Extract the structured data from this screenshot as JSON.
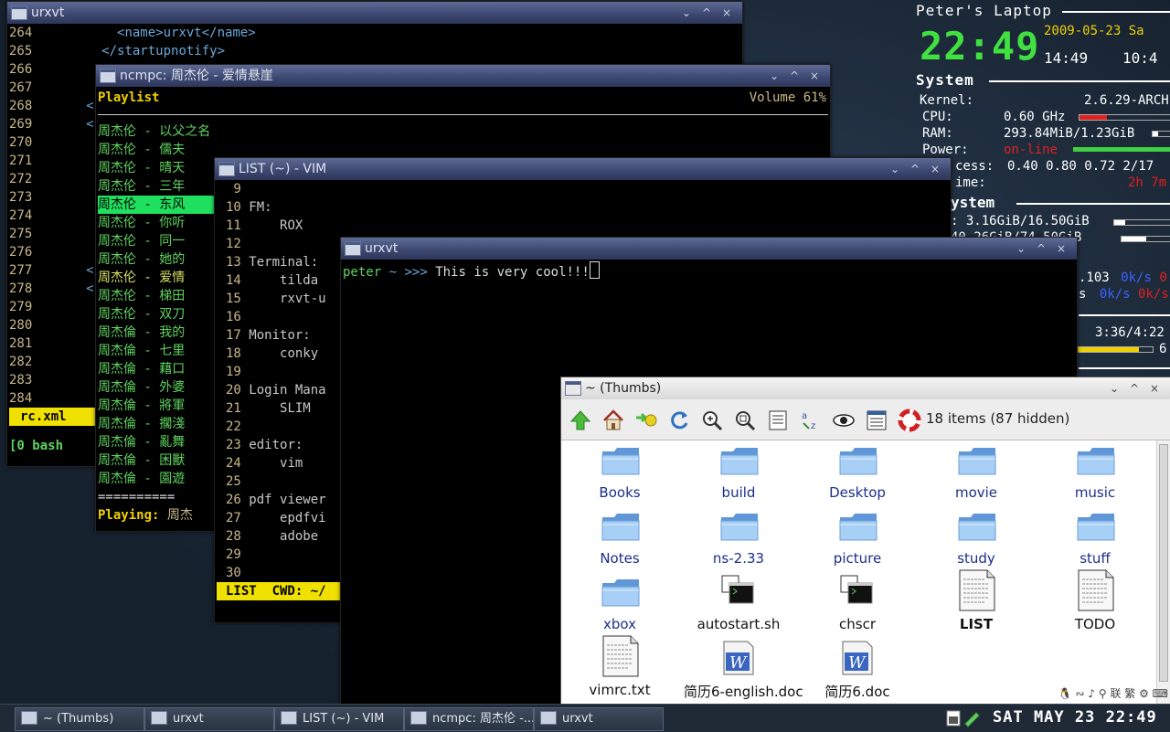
{
  "colors": {
    "accent": "#f0e000",
    "green": "#5fd35f",
    "xml_tag": "#6aa7d8",
    "line_no": "#c8b88a",
    "conky_red": "#e02020",
    "conky_green": "#40d040"
  },
  "win_urxvt1": {
    "title": "urxvt",
    "controls": [
      "⌄",
      "^",
      "×"
    ],
    "lines": [
      {
        "n": "264",
        "t": "        <name>urxvt</name>"
      },
      {
        "n": "265",
        "t": "      </startupnotify>"
      },
      {
        "n": "266",
        "t": ""
      },
      {
        "n": "267",
        "t": ""
      },
      {
        "n": "268",
        "t": "    </"
      },
      {
        "n": "269",
        "t": "    <"
      },
      {
        "n": "270",
        "t": ""
      },
      {
        "n": "271",
        "t": ""
      },
      {
        "n": "272",
        "t": ""
      },
      {
        "n": "273",
        "t": ""
      },
      {
        "n": "274",
        "t": ""
      },
      {
        "n": "275",
        "t": ""
      },
      {
        "n": "276",
        "t": ""
      },
      {
        "n": "277",
        "t": "    </"
      },
      {
        "n": "278",
        "t": "    <"
      },
      {
        "n": "279",
        "t": ""
      },
      {
        "n": "280",
        "t": ""
      },
      {
        "n": "281",
        "t": ""
      },
      {
        "n": "282",
        "t": ""
      },
      {
        "n": "283",
        "t": ""
      },
      {
        "n": "284",
        "t": ""
      }
    ],
    "status_file": "rc.xml",
    "tmux": "[0 bash"
  },
  "win_ncmpc": {
    "title": "ncmpc: 周杰伦 - 爱情悬崖",
    "controls": [
      "⌄",
      "^",
      "×"
    ],
    "header_left": "Playlist",
    "header_right": "Volume 61%",
    "songs": [
      "周杰伦 - 以父之名",
      "周杰伦 - 儒夫",
      "周杰伦 - 晴天",
      "周杰伦 - 三年",
      "周杰伦 - 东风",
      "周杰伦 - 你听",
      "周杰伦 - 同一",
      "周杰伦 - 她的",
      "周杰伦 - 爱情",
      "周杰伦 - 梯田",
      "周杰伦 - 双刀",
      "周杰倫 - 我的",
      "周杰倫 - 七里",
      "周杰倫 - 藉口",
      "周杰倫 - 外婆",
      "周杰倫 - 將軍",
      "周杰倫 - 擱淺",
      "周杰倫 - 亂舞",
      "周杰倫 - 困獸",
      "周杰倫 - 園遊"
    ],
    "selected_index": 4,
    "separator": "==========",
    "playing_label": "Playing:",
    "playing_value": "周杰"
  },
  "win_vim": {
    "title": "LIST (~) - VIM",
    "controls": [
      "⌄",
      "^",
      "×"
    ],
    "lines": [
      {
        "n": " 9",
        "t": ""
      },
      {
        "n": "10",
        "t": "FM:"
      },
      {
        "n": "11",
        "t": "    ROX"
      },
      {
        "n": "12",
        "t": ""
      },
      {
        "n": "13",
        "t": "Terminal:"
      },
      {
        "n": "14",
        "t": "    tilda"
      },
      {
        "n": "15",
        "t": "    rxvt-u"
      },
      {
        "n": "16",
        "t": ""
      },
      {
        "n": "17",
        "t": "Monitor:"
      },
      {
        "n": "18",
        "t": "    conky"
      },
      {
        "n": "19",
        "t": ""
      },
      {
        "n": "20",
        "t": "Login Mana"
      },
      {
        "n": "21",
        "t": "    SLIM"
      },
      {
        "n": "22",
        "t": ""
      },
      {
        "n": "23",
        "t": "editor:"
      },
      {
        "n": "24",
        "t": "    vim"
      },
      {
        "n": "25",
        "t": ""
      },
      {
        "n": "26",
        "t": "pdf viewer"
      },
      {
        "n": "27",
        "t": "    epdfvi"
      },
      {
        "n": "28",
        "t": "    adobe"
      },
      {
        "n": "29",
        "t": ""
      },
      {
        "n": "30",
        "t": ""
      }
    ],
    "status": "LIST  CWD: ~/"
  },
  "win_urxvt2": {
    "title": "urxvt",
    "controls": [
      "⌄",
      "^",
      "×"
    ],
    "prompt_user": "peter",
    "prompt_path": "~",
    "prompt_sym": ">>>",
    "command": "This is very cool!!!"
  },
  "conky": {
    "host": "Peter's Laptop",
    "time_big": "22:49",
    "date": "2009-05-23 Sa",
    "time_a": "14:49",
    "time_b": "10:4",
    "sec_system": "System",
    "kernel_label": "Kernel:",
    "kernel_val": "2.6.29-ARCH",
    "cpu_label": "CPU:",
    "cpu_val": "0.60 GHz",
    "ram_label": "RAM:",
    "ram_val": "293.84MiB/1.23GiB",
    "power_label": "Power:",
    "power_val": "on-line",
    "process_label": "cess:",
    "process_val": "0.40 0.80 0.72 2/17",
    "uptime_label": "ime:",
    "uptime_val": "2h 7m",
    "sec_fs": "ystem",
    "fs1": ": 3.16GiB/16.50GiB",
    "fs2": "40.26GiB/74.50GiB",
    "net1a": ".103",
    "net1b": "0k/s",
    "net1c": "0",
    "net2a": "s",
    "net2b": "0k/s",
    "net2c": "0k/s",
    "mpd_time": "3:36/4:22",
    "mpd_vol": "6"
  },
  "filemanager": {
    "title": "~ (Thumbs)",
    "controls": [
      "⌄",
      "^",
      "×"
    ],
    "summary": "18 items (87 hidden)",
    "toolbar": [
      "up-icon",
      "home-icon",
      "bookmark-icon",
      "refresh-icon",
      "zoom-in-icon",
      "zoom-fit-icon",
      "details-icon",
      "sort-icon",
      "show-hidden-icon",
      "list-view-icon",
      "help-icon"
    ],
    "items": [
      {
        "name": "Books",
        "kind": "folder"
      },
      {
        "name": "build",
        "kind": "folder"
      },
      {
        "name": "Desktop",
        "kind": "folder"
      },
      {
        "name": "movie",
        "kind": "folder"
      },
      {
        "name": "music",
        "kind": "folder"
      },
      {
        "name": "Notes",
        "kind": "folder"
      },
      {
        "name": "ns-2.33",
        "kind": "folder"
      },
      {
        "name": "picture",
        "kind": "folder"
      },
      {
        "name": "study",
        "kind": "folder"
      },
      {
        "name": "stuff",
        "kind": "folder"
      },
      {
        "name": "xbox",
        "kind": "folder"
      },
      {
        "name": "autostart.sh",
        "kind": "script"
      },
      {
        "name": "chscr",
        "kind": "script"
      },
      {
        "name": "LIST",
        "kind": "text"
      },
      {
        "name": "TODO",
        "kind": "text"
      },
      {
        "name": "vimrc.txt",
        "kind": "text"
      },
      {
        "name": "简历6-english.doc",
        "kind": "doc"
      },
      {
        "name": "简历6.doc",
        "kind": "doc"
      }
    ]
  },
  "taskbar": {
    "tasks": [
      "~ (Thumbs)",
      "urxvt",
      "LIST (~) - VIM",
      "ncmpc: 周杰伦 -...",
      "urxvt"
    ],
    "clock": "SAT MAY 23 22:49",
    "tray": "🐧 ∾ ♪ ⚲ 联 繁 ⚙ ⌨"
  }
}
